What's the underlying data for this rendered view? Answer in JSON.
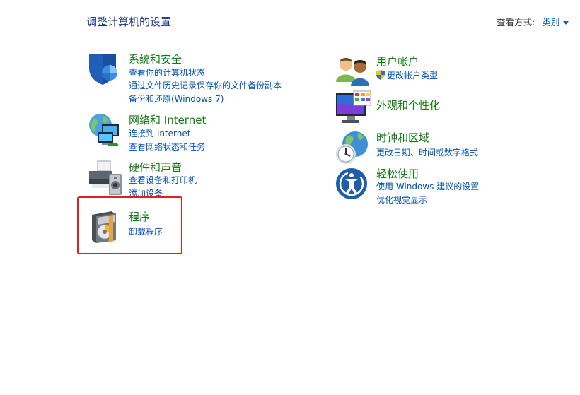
{
  "header": {
    "title": "调整计算机的设置",
    "view_by_label": "查看方式:",
    "view_by_value": "类别"
  },
  "left": [
    {
      "title": "系统和安全",
      "links": [
        "查看你的计算机状态",
        "通过文件历史记录保存你的文件备份副本",
        "备份和还原(Windows 7)"
      ]
    },
    {
      "title": "网络和 Internet",
      "links": [
        "连接到 Internet",
        "查看网络状态和任务"
      ]
    },
    {
      "title": "硬件和声音",
      "links": [
        "查看设备和打印机",
        "添加设备"
      ]
    },
    {
      "title": "程序",
      "links": [
        "卸载程序"
      ]
    }
  ],
  "right": [
    {
      "title": "用户帐户",
      "links": [
        "更改帐户类型"
      ]
    },
    {
      "title": "外观和个性化",
      "links": []
    },
    {
      "title": "时钟和区域",
      "links": [
        "更改日期、时间或数字格式"
      ]
    },
    {
      "title": "轻松使用",
      "links": [
        "使用 Windows 建议的设置",
        "优化视觉显示"
      ]
    }
  ],
  "colors": {
    "category_title": "#127a12",
    "link": "#0050b0",
    "highlight": "#e02020"
  }
}
